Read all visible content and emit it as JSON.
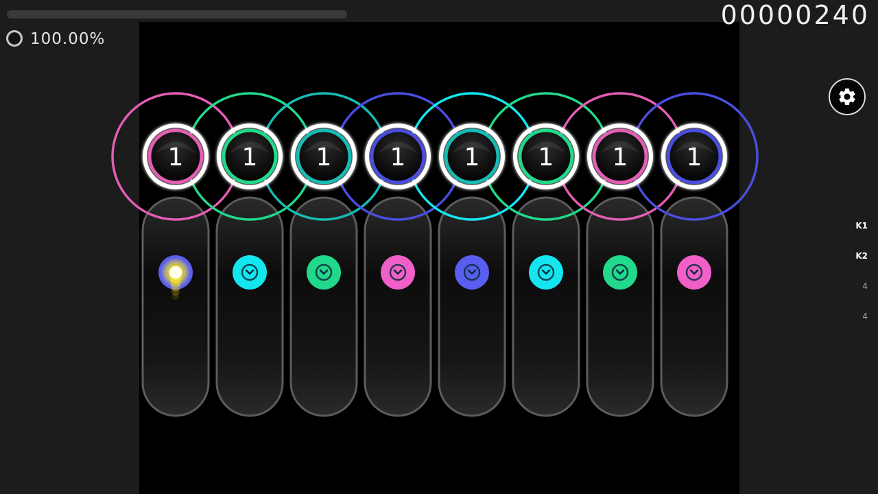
{
  "hud": {
    "score": "00000240",
    "accuracy": "100.00%",
    "song_progress": 0.0
  },
  "keys": [
    {
      "label": "K1",
      "active": true
    },
    {
      "label": "K2",
      "active": true
    },
    {
      "label": "4",
      "active": false
    },
    {
      "label": "4",
      "active": false
    }
  ],
  "icons": {
    "settings": "gear-icon",
    "accuracy": "accuracy-pie-icon",
    "note": "chevron-down-icon"
  },
  "colors": {
    "pink": "#e35eb4",
    "green": "#22d98b",
    "teal": "#17bcb4",
    "blue": "#4a4ee0",
    "cyan": "#14e6f0",
    "cursor": "#fff000"
  },
  "hit_circles": [
    {
      "number": "1",
      "color": "#e35eb4"
    },
    {
      "number": "1",
      "color": "#22d98b"
    },
    {
      "number": "1",
      "color": "#17bcb4"
    },
    {
      "number": "1",
      "color": "#4a4ee0"
    },
    {
      "number": "1",
      "color": "#17bcb4"
    },
    {
      "number": "1",
      "color": "#22d98b"
    },
    {
      "number": "1",
      "color": "#e35eb4"
    },
    {
      "number": "1",
      "color": "#4a4ee0"
    }
  ],
  "approach_circles": [
    {
      "color": "#e35eb4"
    },
    {
      "color": "#22d98b"
    },
    {
      "color": "#17bcb4"
    },
    {
      "color": "#4a4ee0"
    },
    {
      "color": "#14e6f0"
    },
    {
      "color": "#22d98b"
    },
    {
      "color": "#e35eb4"
    },
    {
      "color": "#4a4ee0"
    }
  ],
  "lane_notes": [
    {
      "color": "#5a5ef0"
    },
    {
      "color": "#14e6f0"
    },
    {
      "color": "#22d98b"
    },
    {
      "color": "#f060c8"
    },
    {
      "color": "#5a5ef0"
    },
    {
      "color": "#14e6f0"
    },
    {
      "color": "#22d98b"
    },
    {
      "color": "#f060c8"
    }
  ]
}
